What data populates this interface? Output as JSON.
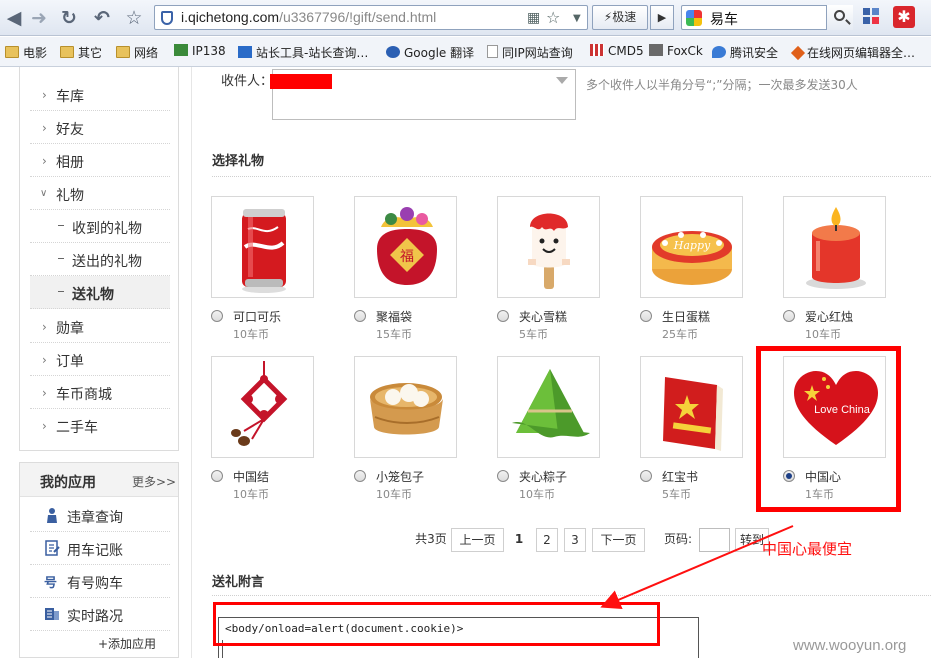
{
  "browser": {
    "url_host": "i.qichetong.com",
    "url_path": "/u3367796/!gift/send.html",
    "speed_label": "极速",
    "search_query": "易车"
  },
  "bookmarks": [
    {
      "label": "电影",
      "icon": "folder-icon"
    },
    {
      "label": "其它",
      "icon": "folder-icon"
    },
    {
      "label": "网络",
      "icon": "folder-icon"
    },
    {
      "label": "IP138",
      "icon": "site-icon"
    },
    {
      "label": "站长工具-站长查询…",
      "icon": "site-icon"
    },
    {
      "label": "Google 翻译",
      "icon": "site-icon"
    },
    {
      "label": "同IP网站查询",
      "icon": "page-icon"
    },
    {
      "label": "CMD5",
      "icon": "site-icon"
    },
    {
      "label": "FoxCk",
      "icon": "site-icon"
    },
    {
      "label": "腾讯安全",
      "icon": "site-icon"
    },
    {
      "label": "在线网页编辑器全…",
      "icon": "site-icon"
    }
  ],
  "sidebar": {
    "items": [
      {
        "label": "车库",
        "expanded": false
      },
      {
        "label": "好友",
        "expanded": false
      },
      {
        "label": "相册",
        "expanded": false
      },
      {
        "label": "礼物",
        "expanded": true
      }
    ],
    "gift_sub": [
      {
        "label": "收到的礼物",
        "active": false
      },
      {
        "label": "送出的礼物",
        "active": false
      },
      {
        "label": "送礼物",
        "active": true
      }
    ],
    "items_after": [
      {
        "label": "勋章"
      },
      {
        "label": "订单"
      },
      {
        "label": "车币商城"
      },
      {
        "label": "二手车"
      }
    ]
  },
  "apps": {
    "title": "我的应用",
    "more": "更多>>",
    "items": [
      {
        "label": "违章查询",
        "icon": "person-icon"
      },
      {
        "label": "用车记账",
        "icon": "ledger-icon"
      },
      {
        "label": "有号购车",
        "icon": "number-icon"
      },
      {
        "label": "实时路况",
        "icon": "traffic-icon"
      }
    ],
    "add": "+添加应用"
  },
  "form": {
    "recipient_label": "收件人：",
    "recipient_hint": "多个收件人以半角分号“;”分隔；一次最多发送30人",
    "gifts_title": "选择礼物",
    "message_title": "送礼附言",
    "message_value": "<body/onload=alert(document.cookie)>"
  },
  "gifts": [
    {
      "name": "可口可乐",
      "price": "10车币",
      "selected": false,
      "icon": "cola-can-icon"
    },
    {
      "name": "聚福袋",
      "price": "15车币",
      "selected": false,
      "icon": "lucky-bag-icon"
    },
    {
      "name": "夹心雪糕",
      "price": "5车币",
      "selected": false,
      "icon": "ice-cream-icon"
    },
    {
      "name": "生日蛋糕",
      "price": "25车币",
      "selected": false,
      "icon": "birthday-cake-icon"
    },
    {
      "name": "爱心红烛",
      "price": "10车币",
      "selected": false,
      "icon": "candle-icon"
    },
    {
      "name": "中国结",
      "price": "10车币",
      "selected": false,
      "icon": "chinese-knot-icon"
    },
    {
      "name": "小笼包子",
      "price": "10车币",
      "selected": false,
      "icon": "steamed-buns-icon"
    },
    {
      "name": "夹心粽子",
      "price": "10车币",
      "selected": false,
      "icon": "zongzi-icon"
    },
    {
      "name": "红宝书",
      "price": "5车币",
      "selected": false,
      "icon": "red-book-icon"
    },
    {
      "name": "中国心",
      "price": "1车币",
      "selected": true,
      "icon": "china-heart-icon"
    }
  ],
  "heart_text": "Love China",
  "pager": {
    "total": "共3页",
    "prev": "上一页",
    "pages": [
      "1",
      "2",
      "3"
    ],
    "current": "1",
    "next": "下一页",
    "goto_label": "页码:",
    "goto_button": "转到"
  },
  "annotation": "中国心最便宜",
  "watermark": "www.wooyun.org",
  "colors": {
    "highlight": "#ff0000",
    "accent": "#1d3f86"
  }
}
